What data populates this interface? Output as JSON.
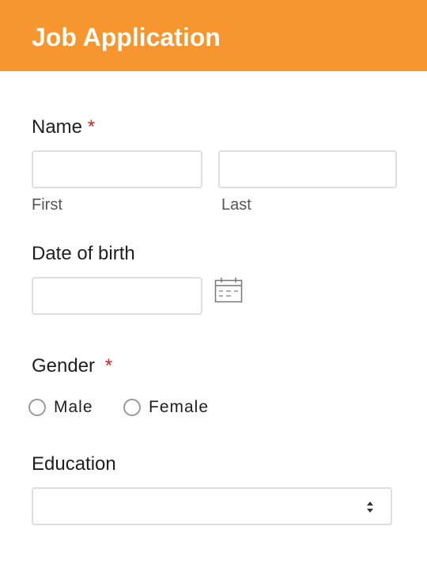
{
  "header": {
    "title": "Job Application"
  },
  "name": {
    "label": "Name",
    "required_mark": "*",
    "first_value": "",
    "last_value": "",
    "first_sublabel": "First",
    "last_sublabel": "Last"
  },
  "dob": {
    "label": "Date of birth",
    "value": "",
    "icon": "calendar-icon"
  },
  "gender": {
    "label": "Gender",
    "required_mark": "*",
    "options": [
      "Male",
      "Female"
    ]
  },
  "education": {
    "label": "Education",
    "selected": "",
    "icon": "select-arrows-icon"
  },
  "colors": {
    "header_bg": "#f7952f",
    "required": "#e02020"
  }
}
